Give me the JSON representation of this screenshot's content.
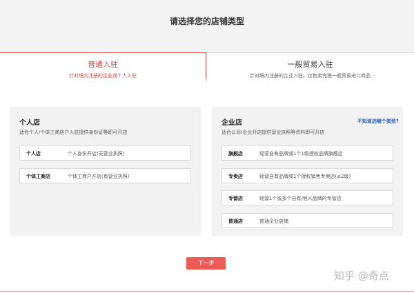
{
  "header": {
    "title": "请选择您的店铺类型"
  },
  "tabs": [
    {
      "label": "普通入驻",
      "sub": "针对境内注册的企业或个人入驻"
    },
    {
      "label": "一般贸易入驻",
      "sub": "针对境内注册的企业入驻，仅售卖完税一般贸易进口商品"
    }
  ],
  "personal": {
    "title": "个人店",
    "desc": "适合个人/个体工商店户入驻提供身份证等即可开店",
    "options": [
      {
        "name": "个人店",
        "desc": "个人身份开店(无营业执照)"
      },
      {
        "name": "个体工商店",
        "desc": "个体工商户开店(有营业执照)"
      }
    ]
  },
  "enterprise": {
    "title": "企业店",
    "help": "不知道选哪个类型?",
    "desc": "适合公司/企业开店提供营业执照等资料即可开店",
    "options": [
      {
        "name": "旗舰店",
        "desc": "经营自有品牌或1个1级授权品牌旗舰店"
      },
      {
        "name": "专卖店",
        "desc": "经营自有品牌或1个授权销售专卖店(≤2级)"
      },
      {
        "name": "专营店",
        "desc": "经营1个或多个自有/他人品牌的专营店"
      },
      {
        "name": "普通店",
        "desc": "普通企业店铺"
      }
    ]
  },
  "actions": {
    "next": "下一步"
  },
  "watermark": "知乎 @奇点",
  "colors": {
    "accent": "#d84b4b",
    "button": "#ef5a55",
    "link": "#2a5fb0"
  }
}
